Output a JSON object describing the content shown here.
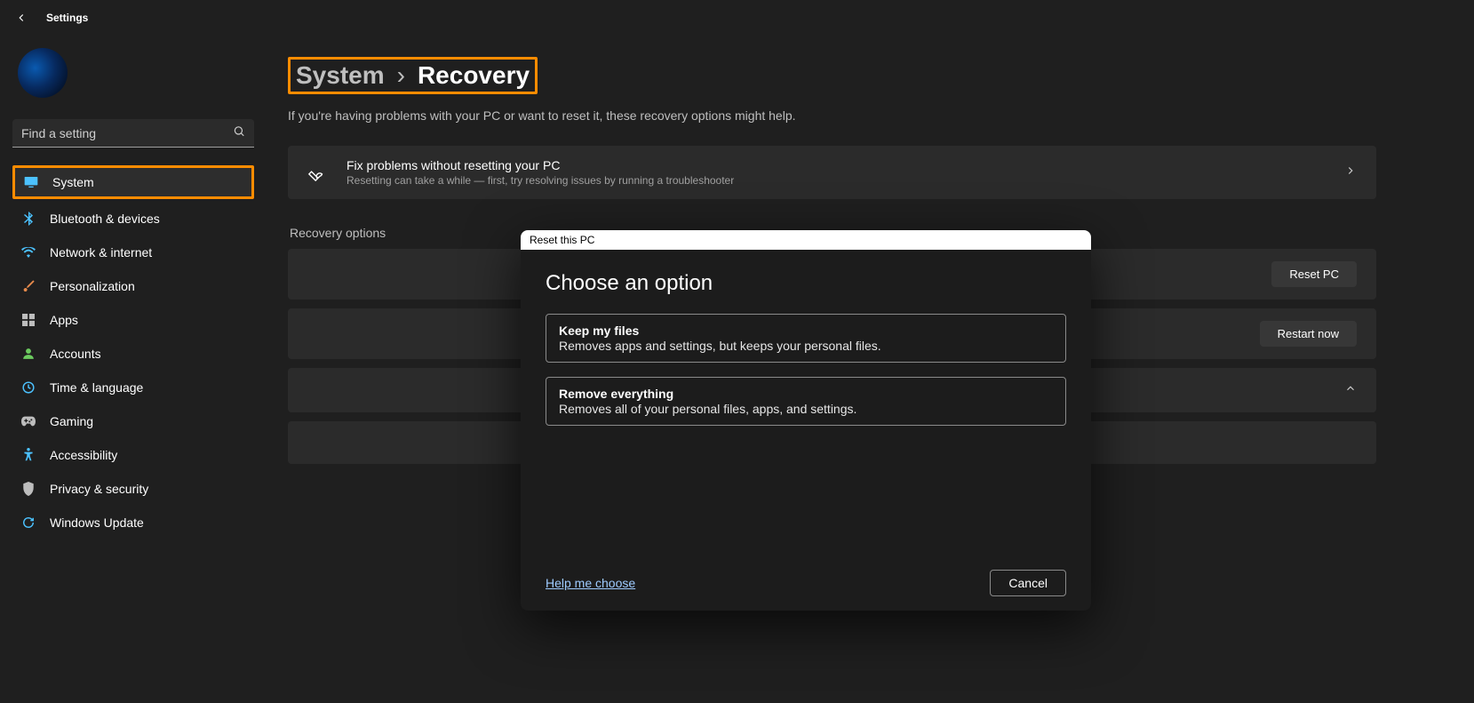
{
  "app": {
    "title": "Settings"
  },
  "search": {
    "placeholder": "Find a setting"
  },
  "sidebar": {
    "items": [
      {
        "label": "System"
      },
      {
        "label": "Bluetooth & devices"
      },
      {
        "label": "Network & internet"
      },
      {
        "label": "Personalization"
      },
      {
        "label": "Apps"
      },
      {
        "label": "Accounts"
      },
      {
        "label": "Time & language"
      },
      {
        "label": "Gaming"
      },
      {
        "label": "Accessibility"
      },
      {
        "label": "Privacy & security"
      },
      {
        "label": "Windows Update"
      }
    ]
  },
  "breadcrumb": {
    "parent": "System",
    "current": "Recovery"
  },
  "subtitle": "If you're having problems with your PC or want to reset it, these recovery options might help.",
  "cards": {
    "troubleshoot": {
      "title": "Fix problems without resetting your PC",
      "desc": "Resetting can take a while — first, try resolving issues by running a troubleshooter"
    },
    "section_label": "Recovery options",
    "reset": {
      "button": "Reset PC"
    },
    "restart": {
      "button": "Restart now"
    }
  },
  "dialog": {
    "titlebar": "Reset this PC",
    "heading": "Choose an option",
    "options": [
      {
        "title": "Keep my files",
        "desc": "Removes apps and settings, but keeps your personal files."
      },
      {
        "title": "Remove everything",
        "desc": "Removes all of your personal files, apps, and settings."
      }
    ],
    "help": "Help me choose",
    "cancel": "Cancel"
  }
}
